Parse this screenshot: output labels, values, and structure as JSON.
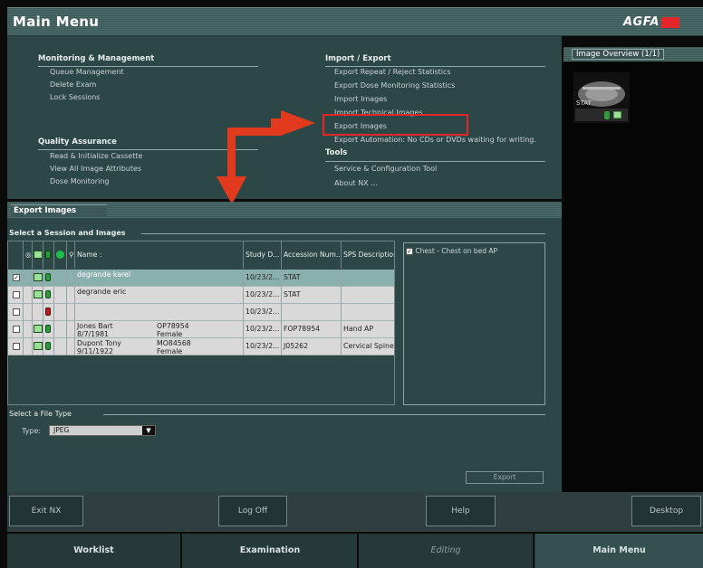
{
  "header": {
    "title": "Main Menu",
    "brand": "AGFA",
    "brand_color": "#e3262a"
  },
  "menu": {
    "monitoring": {
      "title": "Monitoring & Management",
      "items": [
        "Queue Management",
        "Delete Exam",
        "Lock Sessions"
      ]
    },
    "quality": {
      "title": "Quality Assurance",
      "items": [
        "Read & Initialize Cassette",
        "View All Image Attributes",
        "Dose Monitoring"
      ]
    },
    "import_export": {
      "title": "Import / Export",
      "items": [
        "Export Repeat / Reject Statistics",
        "Export Dose Monitoring Statistics",
        "Import Images",
        "Import Technical Images",
        "Export Images",
        "Export Automation: No CDs or DVDs waiting for writing."
      ]
    },
    "tools": {
      "title": "Tools",
      "items": [
        "Service & Configuration Tool",
        "About NX ..."
      ]
    }
  },
  "overview": {
    "title": "Image Overview (1/1)",
    "thumb_text": "STAT"
  },
  "export_panel": {
    "title": "Export Images",
    "select_session": "Select a Session and Images",
    "columns": {
      "name": "Name :",
      "study": "Study D...",
      "accession": "Accession Num...",
      "sps": "SPS Description"
    },
    "rows": [
      {
        "checked": "✓",
        "name": "degrande karel",
        "id": "",
        "sex": "",
        "dob": "",
        "study": "10/23/2...",
        "accession": "STAT",
        "sps": ""
      },
      {
        "checked": "",
        "name": "degrande eric",
        "id": "",
        "sex": "",
        "dob": "",
        "study": "10/23/2...",
        "accession": "STAT",
        "sps": ""
      },
      {
        "checked": "",
        "name": "",
        "id": "",
        "sex": "",
        "dob": "",
        "study": "10/23/2...",
        "accession": "",
        "sps": ""
      },
      {
        "checked": "",
        "name": "Jones Bart",
        "id": "OP78954",
        "sex": "Female",
        "dob": "8/7/1981",
        "study": "10/23/2...",
        "accession": "FOP78954",
        "sps": "Hand AP"
      },
      {
        "checked": "",
        "name": "Dupont Tony",
        "id": "MO84568",
        "sex": "Female",
        "dob": "9/11/1922",
        "study": "10/23/2...",
        "accession": "J05262",
        "sps": "Cervical Spine..."
      }
    ],
    "description_item": {
      "checked": "✓",
      "label": "Chest - Chest on bed AP"
    },
    "select_file_type": "Select a File Type",
    "type_label": "Type:",
    "type_value": "JPEG",
    "export_button": "Export"
  },
  "buttons": {
    "exit": "Exit NX",
    "logoff": "Log Off",
    "help": "Help",
    "desktop": "Desktop"
  },
  "tabs": [
    {
      "label": "Worklist",
      "active": false
    },
    {
      "label": "Examination",
      "active": false
    },
    {
      "label": "Editing",
      "active": false
    },
    {
      "label": "Main Menu",
      "active": true
    }
  ],
  "colors": {
    "highlight": "#e3262a",
    "panel": "#2c4746",
    "arrow": "#e23a1e"
  }
}
